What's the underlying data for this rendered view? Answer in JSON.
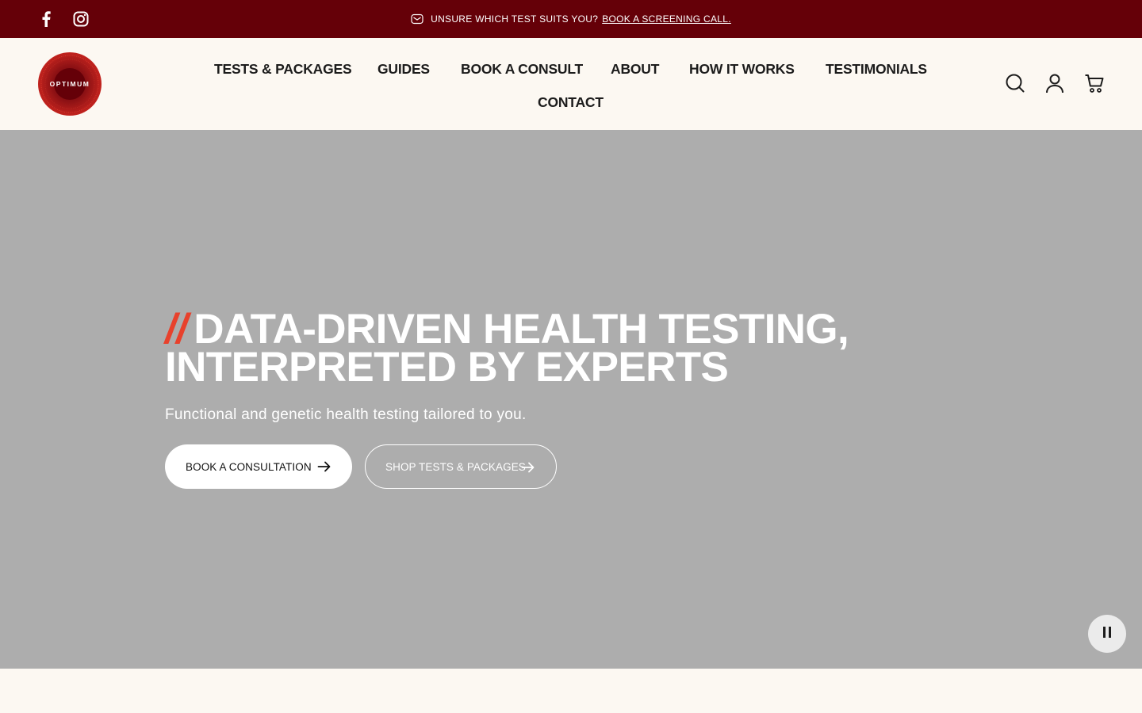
{
  "announcement": {
    "text": "UNSURE WHICH TEST SUITS YOU?",
    "link": "BOOK A SCREENING CALL."
  },
  "social": [
    "facebook-icon",
    "instagram-icon"
  ],
  "brand": {
    "logo_text": "OPTIMUM"
  },
  "nav": {
    "items": [
      {
        "label": "TESTS & PACKAGES"
      },
      {
        "label": "GUIDES"
      },
      {
        "label": "BOOK A CONSULT"
      },
      {
        "label": "ABOUT"
      },
      {
        "label": "HOW IT WORKS"
      },
      {
        "label": "TESTIMONIALS"
      },
      {
        "label": "CONTACT"
      }
    ]
  },
  "header_icons": [
    "search-icon",
    "account-icon",
    "cart-icon"
  ],
  "hero": {
    "slashes": "//",
    "headline_line1": "DATA-DRIVEN HEALTH TESTING,",
    "headline_line2": "INTERPRETED BY EXPERTS",
    "subtitle": "Functional and genetic health testing tailored to you.",
    "primary_button": "BOOK A CONSULTATION",
    "secondary_button": "SHOP TESTS & PACKAGES"
  },
  "colors": {
    "announcement_bg": "#650008",
    "page_bg": "#fcf8f2",
    "hero_bg": "#adadad",
    "accent": "#e8412c"
  }
}
